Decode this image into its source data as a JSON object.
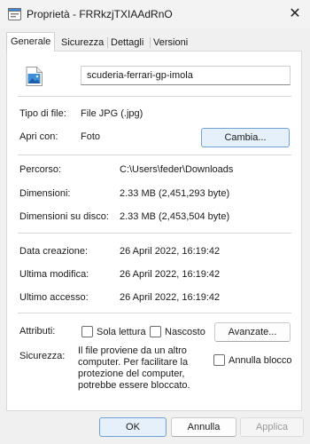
{
  "window": {
    "title": "Proprietà - FRRkzjTXIAAdRnO",
    "close_glyph": "✕"
  },
  "tabs": [
    {
      "label": "Generale",
      "active": true
    },
    {
      "label": "Sicurezza",
      "active": false
    },
    {
      "label": "Dettagli",
      "active": false
    },
    {
      "label": "Versioni precedenti",
      "active": false
    }
  ],
  "general": {
    "filename": "scuderia-ferrari-gp-imola",
    "file_icon": "image-file-icon",
    "type_label": "Tipo di file:",
    "type_value": "File JPG (.jpg)",
    "open_with_label": "Apri con:",
    "open_with_value": "Foto",
    "change_button": "Cambia...",
    "path_label": "Percorso:",
    "path_value": "C:\\Users\\feder\\Downloads",
    "size_label": "Dimensioni:",
    "size_value": "2.33 MB (2,451,293 byte)",
    "disk_size_label": "Dimensioni su disco:",
    "disk_size_value": "2.33 MB (2,453,504 byte)",
    "created_label": "Data creazione:",
    "created_value": "26 April 2022, 16:19:42",
    "modified_label": "Ultima modifica:",
    "modified_value": "26 April 2022, 16:19:42",
    "accessed_label": "Ultimo accesso:",
    "accessed_value": "26 April 2022, 16:19:42",
    "attributes_label": "Attributi:",
    "readonly_label": "Sola lettura",
    "readonly_checked": false,
    "hidden_label": "Nascosto",
    "hidden_checked": false,
    "advanced_button": "Avanzate...",
    "security_label": "Sicurezza:",
    "security_lines": [
      "Il file proviene da un altro",
      "computer. Per facilitare la",
      "protezione del computer,",
      "potrebbe essere bloccato."
    ],
    "unblock_label": "Annulla blocco",
    "unblock_checked": false
  },
  "footer": {
    "ok": "OK",
    "cancel": "Annulla",
    "apply": "Applica"
  },
  "colors": {
    "accent": "#1a73c8",
    "primary_button_bg": "#e6f0fb",
    "primary_button_border": "#6ea1d7",
    "disabled_text": "#9a9a9a"
  }
}
